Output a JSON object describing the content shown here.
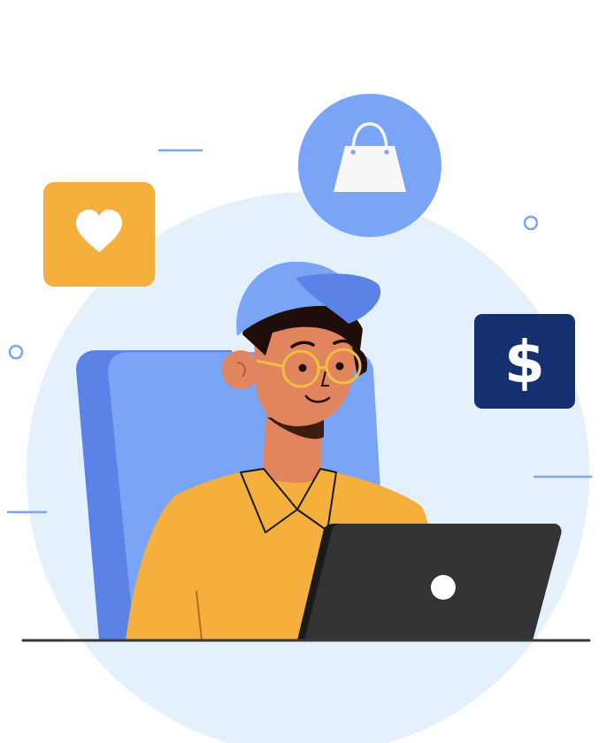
{
  "scene": {
    "subject": "person-with-cap-and-glasses-using-laptop",
    "icons": [
      "heart-icon",
      "shopping-bag-icon",
      "dollar-icon"
    ],
    "dollar_icon_glyph": "$"
  },
  "colors": {
    "background": "#ffffff",
    "backdrop_circle": "#e4f0fc",
    "accent_blue": "#7aa4f6",
    "dark_blue": "#5b82e6",
    "orange": "#f5af3d",
    "navy": "#15306e",
    "skin": "#e1855f",
    "hair": "#1e0d08",
    "glasses": "#f0bf3f",
    "laptop": "#333333",
    "desk_line": "#3a3a3a",
    "bag": "#f8f8f8"
  }
}
